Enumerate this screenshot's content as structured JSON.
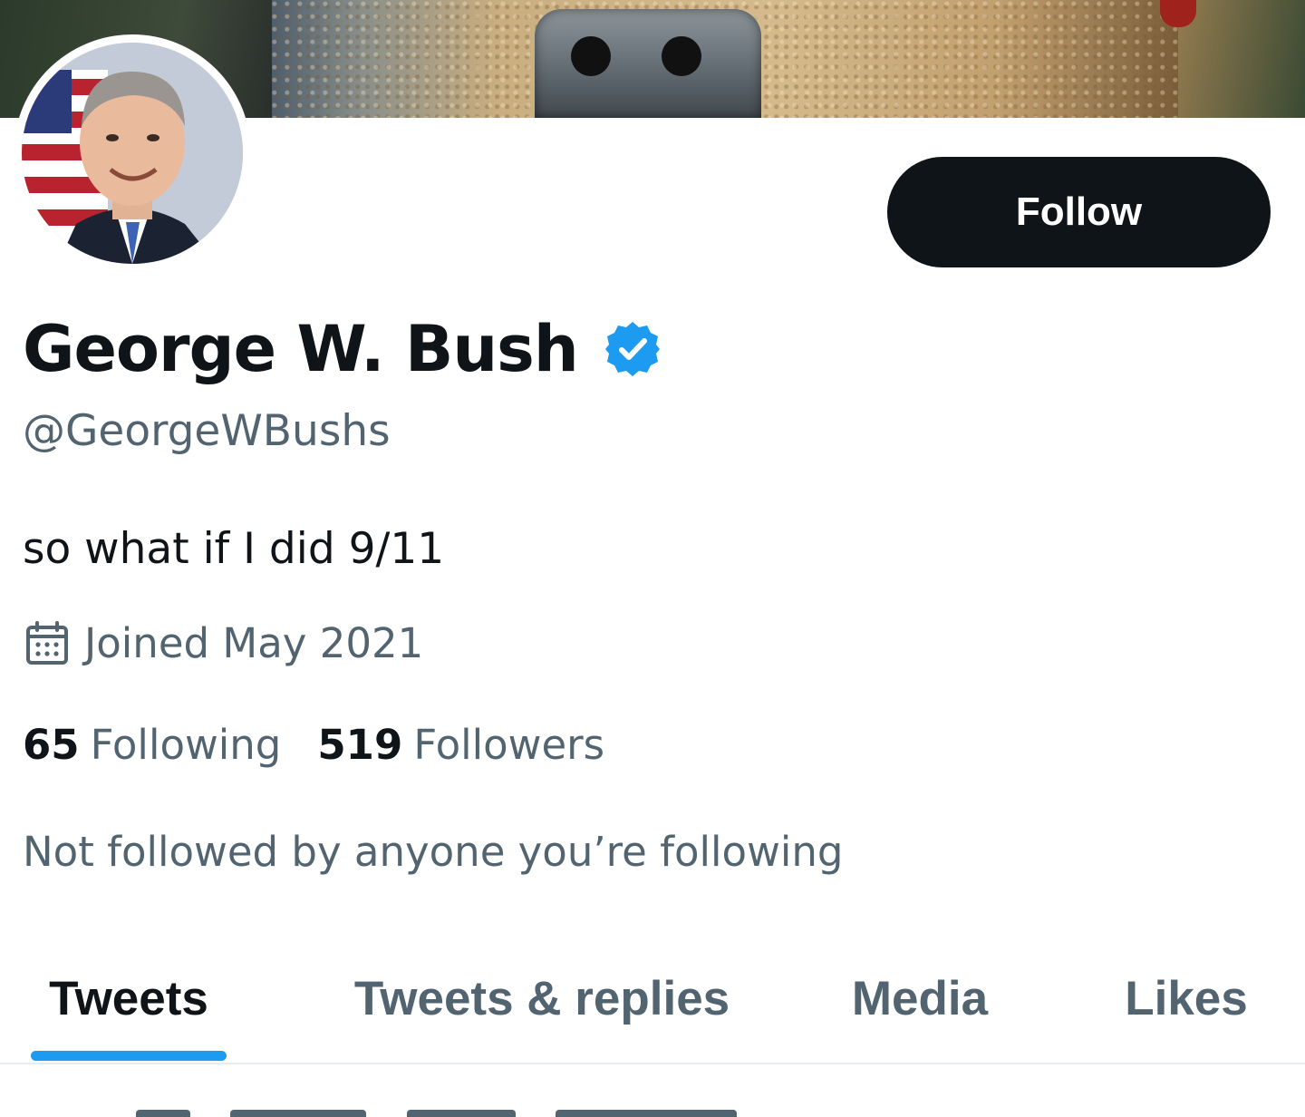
{
  "profile": {
    "display_name": "George W. Bush",
    "handle": "@GeorgeWBushs",
    "bio": "so what if I did 9/11",
    "joined": "Joined May 2021",
    "following_count": "65",
    "following_label": "Following",
    "followers_count": "519",
    "followers_label": "Followers",
    "followed_by": "Not followed by anyone you’re following",
    "verified": true
  },
  "actions": {
    "follow_label": "Follow"
  },
  "tabs": [
    {
      "label": "Tweets",
      "active": true
    },
    {
      "label": "Tweets & replies",
      "active": false
    },
    {
      "label": "Media",
      "active": false
    },
    {
      "label": "Likes",
      "active": false
    }
  ],
  "icons": {
    "verified": "verified-badge-icon",
    "calendar": "calendar-icon"
  },
  "colors": {
    "text_primary": "#0f1419",
    "text_secondary": "#536471",
    "accent": "#1d9bf0",
    "button_bg": "#0f1419",
    "button_text": "#ffffff",
    "divider": "#e6ecf0"
  }
}
